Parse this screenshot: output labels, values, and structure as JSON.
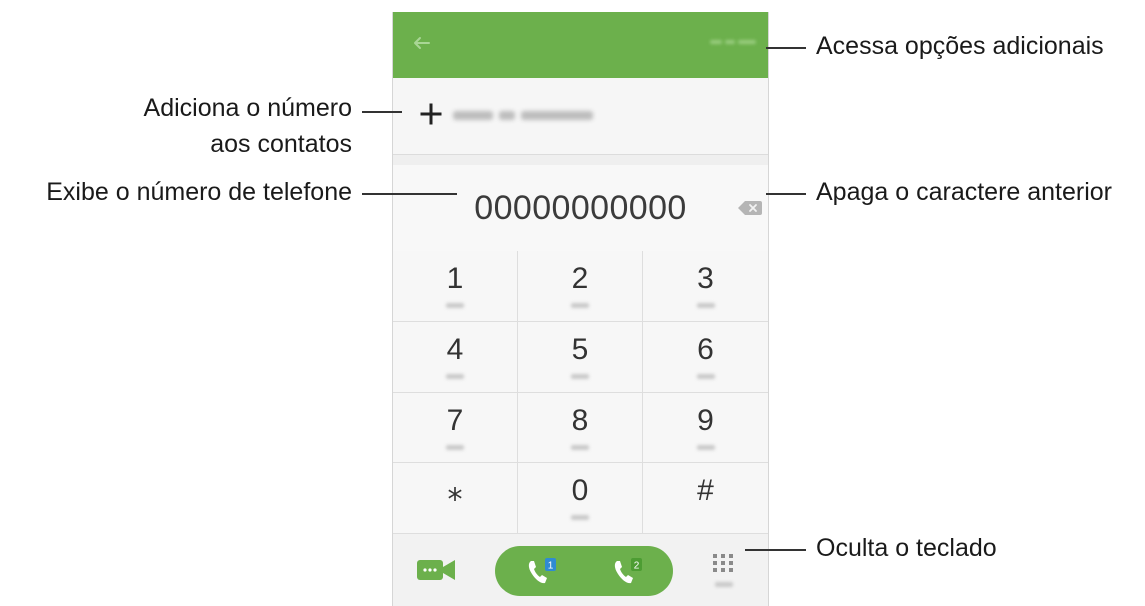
{
  "dialer": {
    "number": "00000000000",
    "keys": [
      {
        "digit": "1"
      },
      {
        "digit": "2"
      },
      {
        "digit": "3"
      },
      {
        "digit": "4"
      },
      {
        "digit": "5"
      },
      {
        "digit": "6"
      },
      {
        "digit": "7"
      },
      {
        "digit": "8"
      },
      {
        "digit": "9"
      },
      {
        "digit": "⁎"
      },
      {
        "digit": "0"
      },
      {
        "digit": "#"
      }
    ],
    "sim_call_badges": [
      "1",
      "2"
    ]
  },
  "callouts": {
    "more_options": "Acessa opções adicionais",
    "add_contact_line1": "Adiciona o número",
    "add_contact_line2": "aos contatos",
    "show_number": "Exibe o número de telefone",
    "delete_char": "Apaga o caractere anterior",
    "hide_keypad": "Oculta o teclado"
  },
  "colors": {
    "brand_green": "#6cb04c",
    "screen_background": "#f2f2f2"
  },
  "icons": [
    "back-arrow-icon",
    "more-options-icon",
    "plus-icon",
    "backspace-icon",
    "video-call-icon",
    "sim1-call-icon",
    "sim2-call-icon",
    "keypad-icon"
  ]
}
